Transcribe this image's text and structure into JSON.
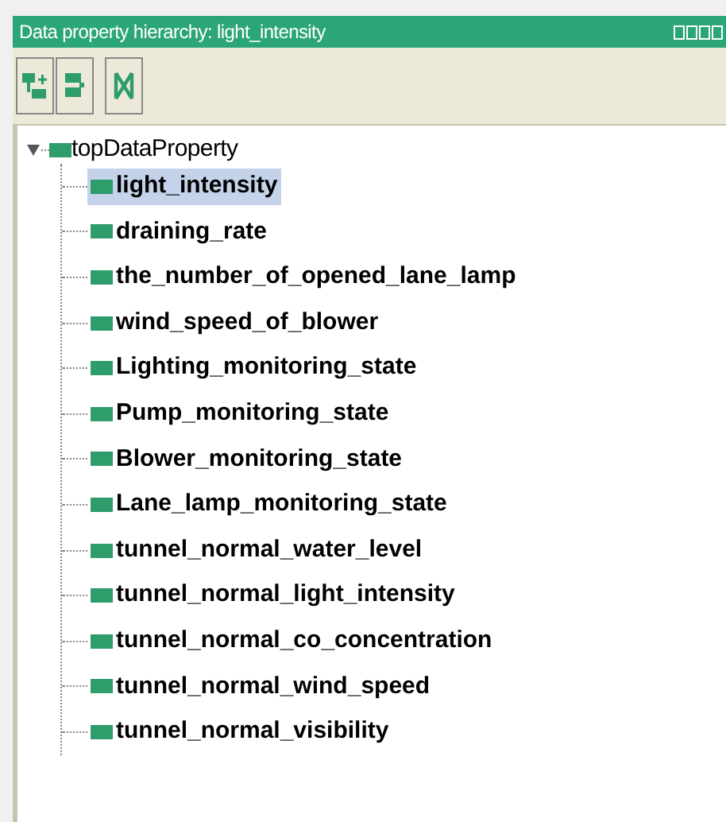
{
  "window": {
    "title": "Data property hierarchy: light_intensity"
  },
  "toolbar": [
    {
      "kind": "add-sub"
    },
    {
      "kind": "add-sibling"
    },
    {
      "kind": "delete"
    }
  ],
  "tree": {
    "label": "topDataProperty",
    "expanded": true,
    "selected": false,
    "children": [
      {
        "label": "light_intensity",
        "selected": true
      },
      {
        "label": "draining_rate",
        "selected": false
      },
      {
        "label": "the_number_of_opened_lane_lamp",
        "selected": false
      },
      {
        "label": "wind_speed_of_blower",
        "selected": false
      },
      {
        "label": "Lighting_monitoring_state",
        "selected": false
      },
      {
        "label": "Pump_monitoring_state",
        "selected": false
      },
      {
        "label": "Blower_monitoring_state",
        "selected": false
      },
      {
        "label": "Lane_lamp_monitoring_state",
        "selected": false
      },
      {
        "label": "tunnel_normal_water_level",
        "selected": false
      },
      {
        "label": "tunnel_normal_light_intensity",
        "selected": false
      },
      {
        "label": "tunnel_normal_co_concentration",
        "selected": false
      },
      {
        "label": "tunnel_normal_wind_speed",
        "selected": false
      },
      {
        "label": "tunnel_normal_visibility",
        "selected": false
      }
    ]
  }
}
